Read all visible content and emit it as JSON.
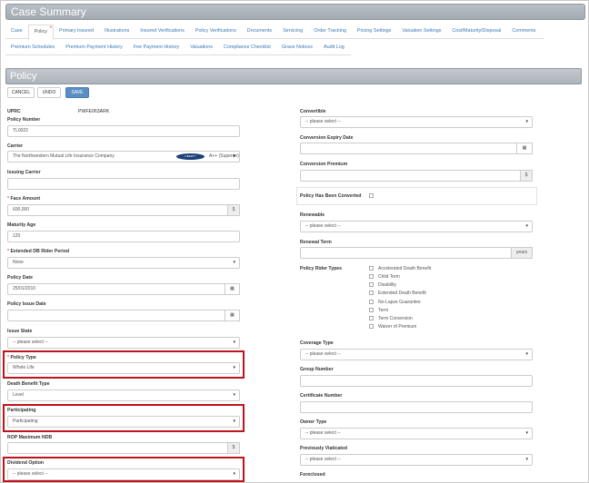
{
  "header": {
    "title": "Case Summary"
  },
  "tabs_row1": [
    {
      "label": "Case"
    },
    {
      "label": "Policy",
      "active": true,
      "dot": "•"
    },
    {
      "label": "Primary Insured"
    },
    {
      "label": "Illustrations"
    },
    {
      "label": "Insured Verifications"
    },
    {
      "label": "Policy Verifications"
    },
    {
      "label": "Documents"
    },
    {
      "label": "Servicing"
    },
    {
      "label": "Order Tracking"
    },
    {
      "label": "Pricing Settings"
    },
    {
      "label": "Valuation Settings"
    },
    {
      "label": "Cost/Maturity/Disposal"
    },
    {
      "label": "Comments"
    }
  ],
  "tabs_row2": [
    {
      "label": "Premium Schedules"
    },
    {
      "label": "Premium Payment History"
    },
    {
      "label": "Fee Payment History"
    },
    {
      "label": "Valuations"
    },
    {
      "label": "Compliance Checklist"
    },
    {
      "label": "Grace Notices"
    },
    {
      "label": "Audit Log"
    }
  ],
  "section": {
    "title": "Policy"
  },
  "toolbar": {
    "cancel": "CANCEL",
    "undo": "UNDO",
    "save": "SAVE"
  },
  "left": {
    "uprc_label": "UPRC",
    "uprc_value": "PWFE063ARK",
    "policy_number_label": "Policy Number",
    "policy_number": "TL0022",
    "carrier_label": "Carrier",
    "carrier": "The Northwestern Mutual Life Insurance Company",
    "carrier_logo": "LIBERTY",
    "carrier_rating": "A++ (Superior)",
    "issuing_carrier_label": "Issuing Carrier",
    "issuing_carrier": "",
    "face_amount_label": "Face Amount",
    "face_amount": "600,000",
    "currency": "$",
    "maturity_age_label": "Maturity Age",
    "maturity_age": "120",
    "extended_db_label": "Extended DB Rider Period",
    "extended_db": "None",
    "policy_date_label": "Policy Date",
    "policy_date": "25/01/2010",
    "policy_issue_date_label": "Policy Issue Date",
    "policy_issue_date": "",
    "issue_state_label": "Issue State",
    "issue_state": "-- please select --",
    "policy_type_label": "Policy Type",
    "policy_type": "Whole Life",
    "death_benefit_type_label": "Death Benefit Type",
    "death_benefit_type": "Level",
    "participating_label": "Participating",
    "participating": "Participating",
    "rop_label": "ROP Maximum NDB",
    "rop": "",
    "dividend_option_label": "Dividend Option",
    "dividend_option": "-- please select --"
  },
  "right": {
    "convertible_label": "Convertible",
    "convertible": "-- please select --",
    "conversion_expiry_label": "Conversion Expiry Date",
    "conversion_expiry": "",
    "conversion_premium_label": "Conversion Premium",
    "conversion_premium": "",
    "policy_converted_label": "Policy Has Been Converted",
    "renewable_label": "Renewable",
    "renewable": "-- please select --",
    "renewal_term_label": "Renewal Term",
    "renewal_term": "",
    "years": "years",
    "rider_types_label": "Policy Rider Types",
    "rider_types": [
      "Accelerated Death Benefit",
      "Child Term",
      "Disability",
      "Extended Death Benefit",
      "No-Lapse Guarantee",
      "Term",
      "Term Conversion",
      "Waiver of Premium"
    ],
    "coverage_type_label": "Coverage Type",
    "coverage_type": "-- please select --",
    "group_number_label": "Group Number",
    "group_number": "",
    "certificate_number_label": "Certificate Number",
    "certificate_number": "",
    "owner_type_label": "Owner Type",
    "owner_type": "-- please select --",
    "previously_viaticated_label": "Previously Viaticated",
    "previously_viaticated": "-- please select --",
    "foreclosed_label": "Foreclosed"
  },
  "icons": {
    "calendar": "calendar-icon",
    "caret": "caret-down-icon"
  },
  "colors": {
    "highlight": "#c0131c",
    "link": "#3a79b4",
    "save": "#5b8fc4"
  }
}
